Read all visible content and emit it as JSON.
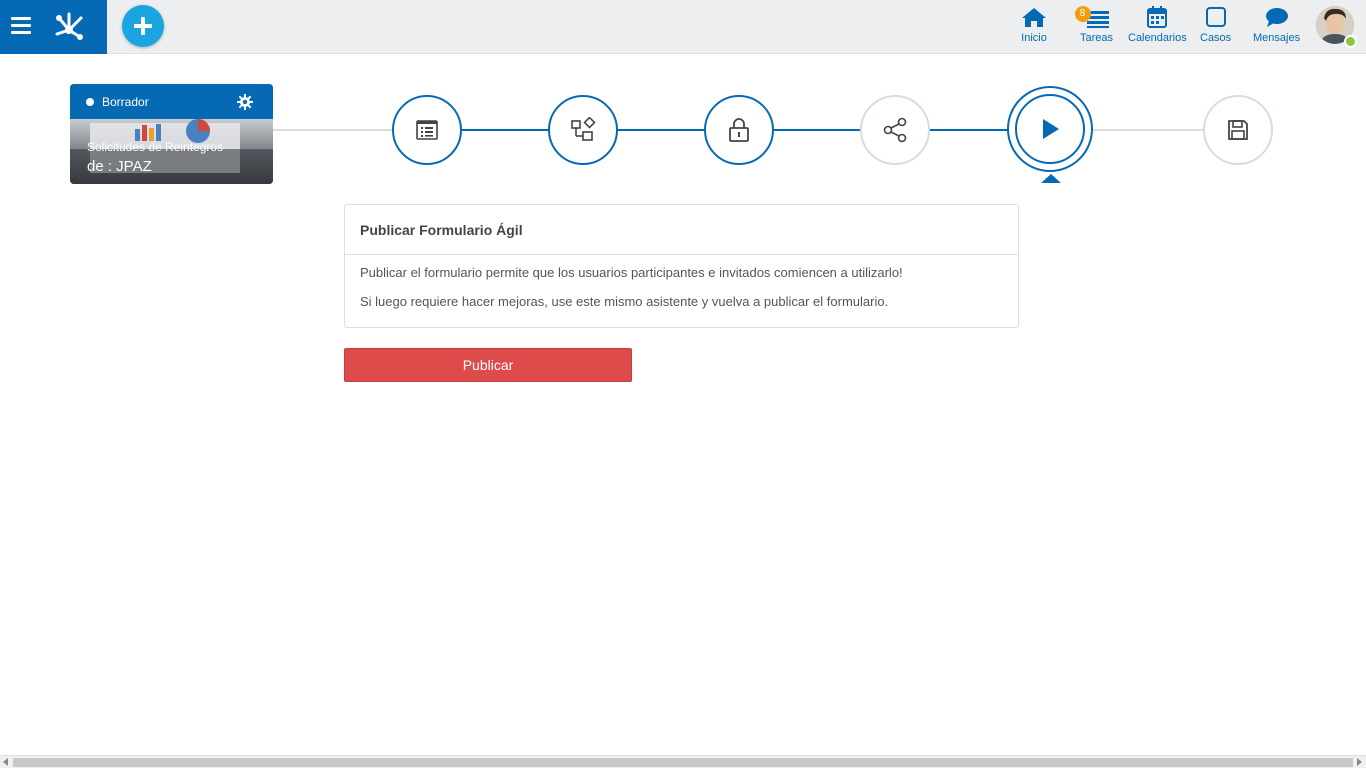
{
  "topbar": {
    "nav": [
      {
        "label": "Inicio",
        "icon": "home-icon"
      },
      {
        "label": "Tareas",
        "icon": "tasks-icon",
        "badge": "8"
      },
      {
        "label": "Calendarios",
        "icon": "calendar-icon"
      },
      {
        "label": "Casos",
        "icon": "cases-icon"
      },
      {
        "label": "Mensajes",
        "icon": "messages-icon"
      }
    ],
    "accent_color": "#0669b4",
    "add_color": "#1aa5e0"
  },
  "form_card": {
    "status": "Borrador",
    "title": "Solicitudes de Reintegros",
    "author": "de : JPAZ"
  },
  "stepper": {
    "steps": [
      {
        "icon": "form-icon",
        "state": "done"
      },
      {
        "icon": "shapes-icon",
        "state": "done"
      },
      {
        "icon": "lock-icon",
        "state": "done"
      },
      {
        "icon": "share-icon",
        "state": "todo"
      },
      {
        "icon": "play-icon",
        "state": "current"
      },
      {
        "icon": "save-icon",
        "state": "todo"
      }
    ]
  },
  "panel": {
    "title": "Publicar Formulario Ágil",
    "line1": "Publicar el formulario permite que los usuarios participantes e invitados comiencen a utilizarlo!",
    "line2": "Si luego requiere hacer mejoras, use este mismo asistente y vuelva a publicar el formulario."
  },
  "actions": {
    "publish_label": "Publicar",
    "publish_color": "#dd4b4b"
  }
}
